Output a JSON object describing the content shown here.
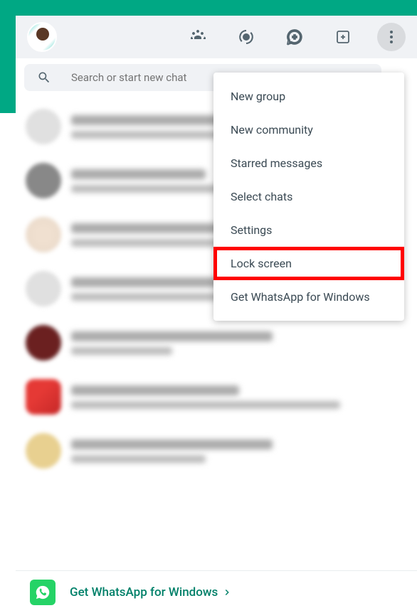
{
  "search": {
    "placeholder": "Search or start new chat"
  },
  "menu": {
    "items": [
      "New group",
      "New community",
      "Starred messages",
      "Select chats",
      "Settings",
      "Lock screen",
      "Get WhatsApp for Windows"
    ]
  },
  "footer": {
    "cta": "Get WhatsApp for Windows"
  }
}
